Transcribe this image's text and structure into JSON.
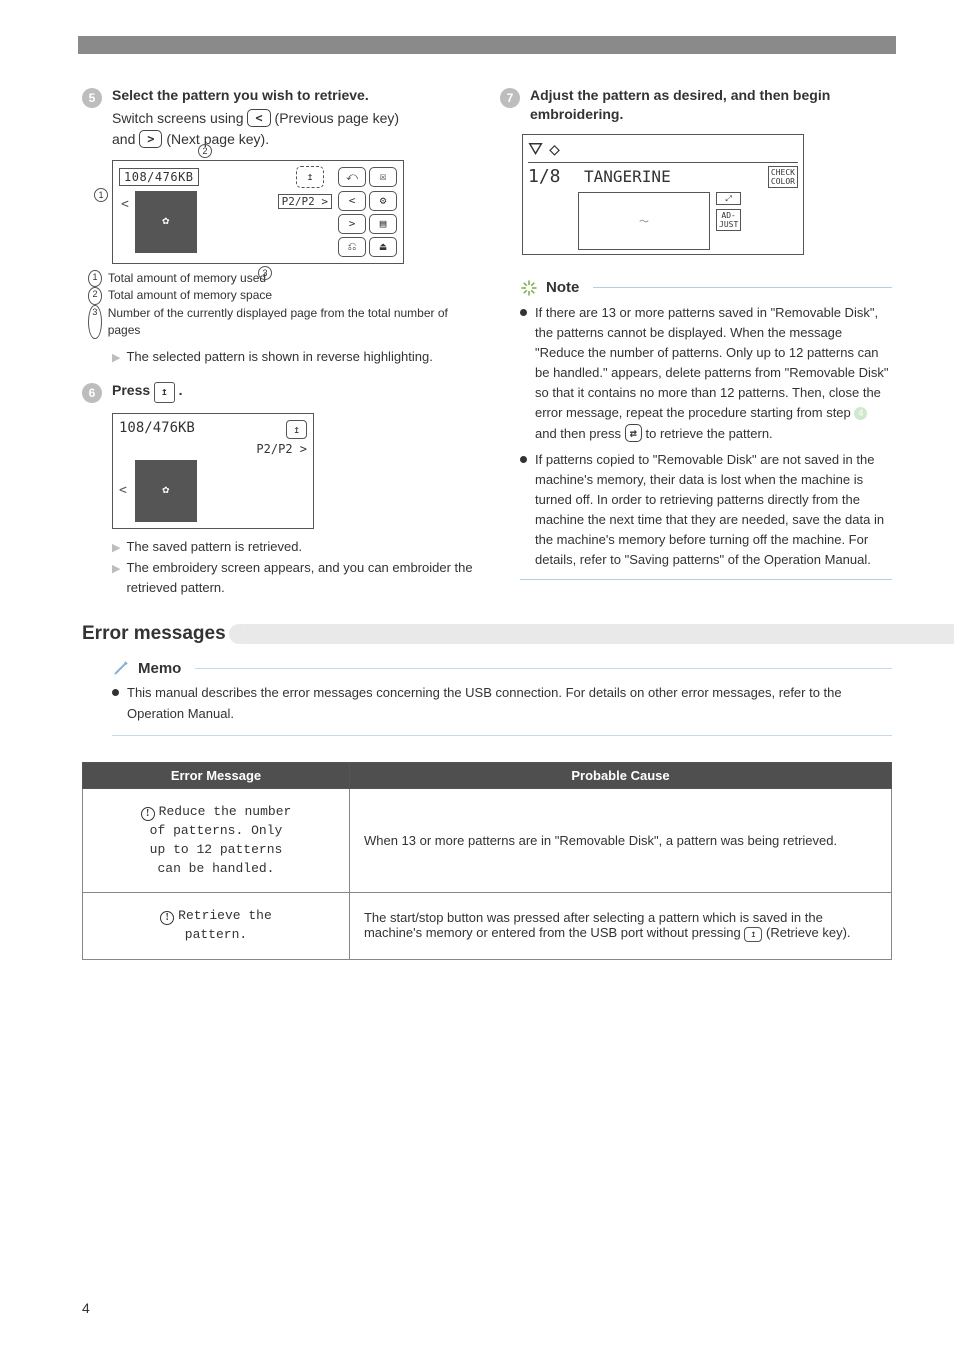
{
  "step5": {
    "title": "Select the pattern you wish to retrieve.",
    "line1a": "Switch screens using ",
    "prev_key_glyph": "<",
    "line1b": "(Previous page key)",
    "line2a": "and ",
    "next_key_glyph": ">",
    "line2b": "(Next page key).",
    "figure": {
      "memory_label": "108/476KB",
      "retrieve_icon_label": "↥",
      "page_indicator": "P2/P2 >",
      "buttons": [
        "⤺",
        "☒",
        "<",
        "⚙",
        ">",
        "▤",
        "⎌",
        "⏏"
      ],
      "left_chevron": "<"
    },
    "callout1": "1",
    "callout2": "2",
    "callout3": "3",
    "legend": [
      "Total amount of memory used",
      "Total amount of memory space",
      "Number of the currently displayed page from the total number of pages"
    ],
    "sub_note": "The selected pattern is shown in reverse highlighting."
  },
  "step6": {
    "title_prefix": "Press ",
    "retrieve_icon_label": "↥",
    "title_suffix": ".",
    "figure": {
      "memory_label": "108/476KB",
      "retrieve_label": "↥",
      "page_indicator": "P2/P2 >",
      "left_chevron": "<"
    },
    "notes": [
      "The saved pattern is retrieved.",
      "The embroidery screen appears, and you can embroider the retrieved pattern."
    ]
  },
  "step7": {
    "title": "Adjust the pattern as desired, and then begin embroidering.",
    "figure": {
      "fraction": "1/8",
      "color_name": "TANGERINE",
      "check_label": "CHECK\nCOLOR",
      "size_btn": "⤢",
      "adjust_btn": "AD-\nJUST"
    }
  },
  "note": {
    "heading": "Note",
    "items": [
      {
        "text_a": "If there are 13 or more patterns saved in \"Removable Disk\", the patterns cannot be displayed. When the message \"Reduce the number of patterns. Only up to 12 patterns can be handled.\" appears, delete patterns from \"Removable Disk\" so that it contains no more than 12 patterns. Then, close the error message, repeat the procedure starting from step ",
        "step_ref": "4",
        "text_b": " and then press ",
        "retrieve_icon": "⇄",
        "text_c": " to retrieve the pattern."
      },
      {
        "text_a": "If patterns copied to \"Removable Disk\" are not saved in the machine's memory, their data is lost when the machine is turned off. In order to retrieving patterns directly from the machine the next time that they are needed, save the data in the machine's memory before turning off the machine. For details, refer to \"Saving patterns\" of the Operation Manual."
      }
    ]
  },
  "section": {
    "title": "Error messages"
  },
  "memo": {
    "heading": "Memo",
    "text": "This manual describes the error messages concerning the USB connection. For details on other error messages, refer to the Operation Manual."
  },
  "table": {
    "headers": [
      "Error Message",
      "Probable Cause"
    ],
    "rows": [
      {
        "message": "Reduce the number\nof patterns. Only\nup to 12 patterns\ncan be handled.",
        "cause": "When 13 or more patterns are in \"Removable Disk\", a pattern was being retrieved."
      },
      {
        "message": "Retrieve the\npattern.",
        "cause_a": "The start/stop button was pressed after selecting a pattern which is saved in the machine's memory or entered from the USB port without pressing ",
        "retrieve_icon": "↥",
        "cause_b": "(Retrieve key)."
      }
    ]
  },
  "page_number": "4"
}
